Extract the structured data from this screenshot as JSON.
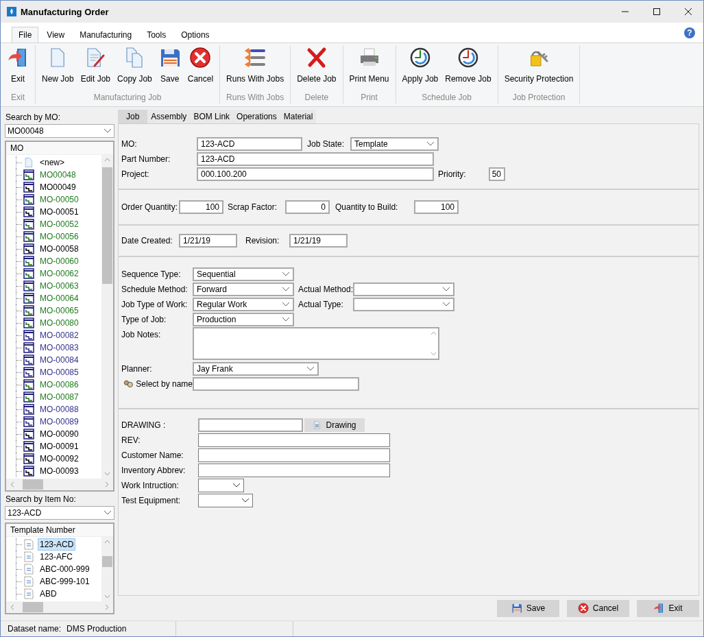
{
  "window": {
    "title": "Manufacturing Order"
  },
  "menu": [
    {
      "label": "File",
      "selected": true
    },
    {
      "label": "View",
      "selected": false
    },
    {
      "label": "Manufacturing",
      "selected": false
    },
    {
      "label": "Tools",
      "selected": false
    },
    {
      "label": "Options",
      "selected": false
    }
  ],
  "help_button": "?",
  "ribbon": [
    {
      "label": "Exit",
      "buttons": [
        {
          "label": "Exit",
          "kind": "exit"
        }
      ]
    },
    {
      "label": "Manufacturing Job",
      "buttons": [
        {
          "label": "New Job",
          "kind": "new"
        },
        {
          "label": "Edit Job",
          "kind": "edit"
        },
        {
          "label": "Copy Job",
          "kind": "copy"
        },
        {
          "label": "Save",
          "kind": "save"
        },
        {
          "label": "Cancel",
          "kind": "cancel"
        }
      ]
    },
    {
      "label": "Runs With Jobs",
      "buttons": [
        {
          "label": "Runs With Jobs",
          "kind": "runs"
        }
      ]
    },
    {
      "label": "Delete",
      "buttons": [
        {
          "label": "Delete Job",
          "kind": "delete"
        }
      ]
    },
    {
      "label": "Print",
      "buttons": [
        {
          "label": "Print Menu",
          "kind": "print"
        }
      ]
    },
    {
      "label": "Schedule Job",
      "buttons": [
        {
          "label": "Apply Job",
          "kind": "apply"
        },
        {
          "label": "Remove Job",
          "kind": "remove"
        }
      ]
    },
    {
      "label": "Job Protection",
      "buttons": [
        {
          "label": "Security Protection",
          "kind": "security"
        }
      ]
    }
  ],
  "search_mo": {
    "label": "Search by MO:",
    "value": "MO00048"
  },
  "mo_tree": {
    "header": "MO",
    "items": [
      {
        "label": "<new>",
        "kind": "new"
      },
      {
        "label": "MO00048",
        "kind": "order",
        "color": "#1e7b1e"
      },
      {
        "label": "MO00049",
        "kind": "order",
        "color": "#000000"
      },
      {
        "label": "MO-00050",
        "kind": "order",
        "color": "#1e7b1e"
      },
      {
        "label": "MO-00051",
        "kind": "order",
        "color": "#000000"
      },
      {
        "label": "MO-00052",
        "kind": "order",
        "color": "#1e7b1e"
      },
      {
        "label": "MO-00056",
        "kind": "order",
        "color": "#1e7b1e"
      },
      {
        "label": "MO-00058",
        "kind": "order",
        "color": "#000000"
      },
      {
        "label": "MO-00060",
        "kind": "order",
        "color": "#1e7b1e"
      },
      {
        "label": "MO-00062",
        "kind": "order",
        "color": "#1e7b1e"
      },
      {
        "label": "MO-00063",
        "kind": "order",
        "color": "#1e7b1e"
      },
      {
        "label": "MO-00064",
        "kind": "order",
        "color": "#1e7b1e"
      },
      {
        "label": "MO-00065",
        "kind": "order",
        "color": "#1e7b1e"
      },
      {
        "label": "MO-00080",
        "kind": "order",
        "color": "#1e7b1e"
      },
      {
        "label": "MO-00082",
        "kind": "order",
        "color": "#33338f"
      },
      {
        "label": "MO-00083",
        "kind": "order",
        "color": "#33338f"
      },
      {
        "label": "MO-00084",
        "kind": "order",
        "color": "#33338f"
      },
      {
        "label": "MO-00085",
        "kind": "order",
        "color": "#33338f"
      },
      {
        "label": "MO-00086",
        "kind": "order",
        "color": "#1e7b1e"
      },
      {
        "label": "MO-00087",
        "kind": "order",
        "color": "#1e7b1e"
      },
      {
        "label": "MO-00088",
        "kind": "order",
        "color": "#33338f"
      },
      {
        "label": "MO-00089",
        "kind": "order",
        "color": "#33338f"
      },
      {
        "label": "MO-00090",
        "kind": "order",
        "color": "#000000"
      },
      {
        "label": "MO-00091",
        "kind": "order",
        "color": "#000000"
      },
      {
        "label": "MO-00092",
        "kind": "order",
        "color": "#000000"
      },
      {
        "label": "MO-00093",
        "kind": "order",
        "color": "#000000"
      }
    ]
  },
  "search_item": {
    "label": "Search by Item No:",
    "value": "123-ACD"
  },
  "template_tree": {
    "header": "Template Number",
    "items": [
      {
        "label": "123-ACD",
        "selected": true
      },
      {
        "label": "123-AFC",
        "selected": false
      },
      {
        "label": "ABC-000-999",
        "selected": false
      },
      {
        "label": "ABC-999-101",
        "selected": false
      },
      {
        "label": "ABD",
        "selected": false
      }
    ]
  },
  "tabs": [
    {
      "label": "Job",
      "selected": true
    },
    {
      "label": "Assembly",
      "selected": false
    },
    {
      "label": "BOM Link",
      "selected": false
    },
    {
      "label": "Operations",
      "selected": false
    },
    {
      "label": "Material",
      "selected": false
    }
  ],
  "job_form": {
    "mo": {
      "label": "MO:",
      "value": "123-ACD"
    },
    "job_state": {
      "label": "Job State:",
      "value": "Template"
    },
    "part_number": {
      "label": "Part Number:",
      "value": "123-ACD"
    },
    "project": {
      "label": "Project:",
      "value": "000.100.200"
    },
    "priority": {
      "label": "Priority:",
      "value": "50"
    },
    "order_quantity": {
      "label": "Order Quantity:",
      "value": "100"
    },
    "scrap_factor": {
      "label": "Scrap Factor:",
      "value": "0"
    },
    "quantity_to_build": {
      "label": "Quantity to Build:",
      "value": "100"
    },
    "date_created": {
      "label": "Date Created:",
      "value": "1/21/19"
    },
    "revision": {
      "label": "Revision:",
      "value": "1/21/19"
    },
    "sequence_type": {
      "label": "Sequence Type:",
      "value": "Sequential"
    },
    "schedule_method": {
      "label": "Schedule Method:",
      "value": "Forward"
    },
    "actual_method": {
      "label": "Actual Method:"
    },
    "job_type_of_work": {
      "label": "Job Type of Work:",
      "value": "Regular Work"
    },
    "actual_type": {
      "label": "Actual Type:"
    },
    "type_of_job": {
      "label": "Type of Job:",
      "value": "Production"
    },
    "job_notes": {
      "label": "Job Notes:"
    },
    "planner": {
      "label": "Planner:",
      "value": "Jay Frank"
    },
    "select_by_name": {
      "label": "Select by name"
    },
    "drawing": {
      "label": "DRAWING :",
      "button": "Drawing"
    },
    "rev": {
      "label": "REV:"
    },
    "customer_name": {
      "label": "Customer Name:"
    },
    "inventory_abbrev": {
      "label": "Inventory Abbrev:"
    },
    "work_intruction": {
      "label": "Work Intruction:"
    },
    "test_equipment": {
      "label": "Test Equipment:"
    }
  },
  "footer_buttons": [
    {
      "label": "Save",
      "kind": "save"
    },
    {
      "label": "Cancel",
      "kind": "cancel"
    },
    {
      "label": "Exit",
      "kind": "exit"
    }
  ],
  "status_bar": {
    "label": "Dataset name:",
    "value": "DMS Production"
  }
}
